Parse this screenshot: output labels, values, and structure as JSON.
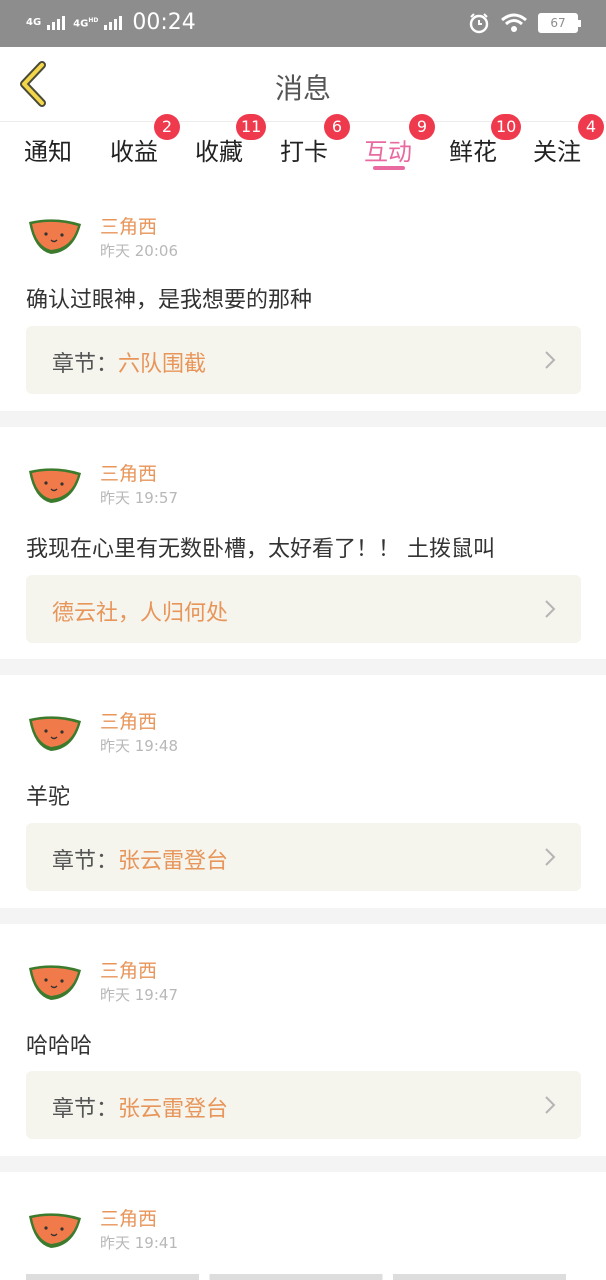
{
  "status": {
    "net1": "4G",
    "net2": "4G",
    "net2_sup": "HD",
    "time": "00:24",
    "battery": "67"
  },
  "header": {
    "title": "消息"
  },
  "tabs": [
    {
      "label": "通知",
      "badge": ""
    },
    {
      "label": "收益",
      "badge": "2"
    },
    {
      "label": "收藏",
      "badge": "11"
    },
    {
      "label": "打卡",
      "badge": "6"
    },
    {
      "label": "互动",
      "badge": "9",
      "active": true
    },
    {
      "label": "鲜花",
      "badge": "10"
    },
    {
      "label": "关注",
      "badge": "4"
    }
  ],
  "messages": [
    {
      "user": "三角西",
      "time": "昨天 20:06",
      "text": "确认过眼神，是我想要的那种",
      "card_prefix": "章节：",
      "card_link": "六队围截"
    },
    {
      "user": "三角西",
      "time": "昨天 19:57",
      "text": "我现在心里有无数卧槽，太好看了！！ 土拨鼠叫",
      "card_prefix": "",
      "card_link": "德云社，人归何处"
    },
    {
      "user": "三角西",
      "time": "昨天 19:48",
      "text": "羊驼",
      "card_prefix": "章节：",
      "card_link": "张云雷登台"
    },
    {
      "user": "三角西",
      "time": "昨天 19:47",
      "text": "哈哈哈",
      "card_prefix": "章节：",
      "card_link": "张云雷登台"
    },
    {
      "user": "三角西",
      "time": "昨天 19:41",
      "text": "",
      "card_prefix": "",
      "card_link": ""
    }
  ],
  "colors": {
    "accent_pink": "#e86aa1",
    "username_orange": "#e8955a",
    "badge_red": "#ef3a4e"
  }
}
